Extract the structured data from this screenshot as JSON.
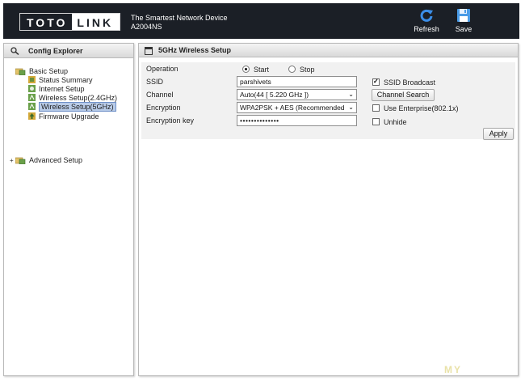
{
  "header": {
    "logo_left": "TOTO",
    "logo_right": "LINK",
    "tagline": "The Smartest Network Device",
    "model": "A2004NS",
    "refresh_label": "Refresh",
    "save_label": "Save"
  },
  "sidebar": {
    "title": "Config Explorer",
    "groups": [
      {
        "label": "Basic Setup",
        "items": [
          {
            "label": "Status Summary"
          },
          {
            "label": "Internet Setup"
          },
          {
            "label": "Wireless Setup(2.4GHz)"
          },
          {
            "label": "Wireless Setup(5GHz)",
            "selected": true
          },
          {
            "label": "Firmware Upgrade"
          }
        ]
      },
      {
        "label": "Advanced Setup",
        "items": []
      }
    ]
  },
  "main": {
    "title": "5GHz Wireless Setup",
    "fields": {
      "operation_label": "Operation",
      "op_start": "Start",
      "op_stop": "Stop",
      "ssid_label": "SSID",
      "ssid_value": "parshivets",
      "channel_label": "Channel",
      "channel_value": "Auto(44 [ 5.220 GHz ])",
      "encryption_label": "Encryption",
      "encryption_value": "WPA2PSK + AES (Recommended",
      "key_label": "Encryption key",
      "key_value": "••••••••••••••"
    },
    "options": {
      "ssid_broadcast": "SSID Broadcast",
      "channel_search": "Channel Search",
      "use_enterprise": "Use Enterprise(802.1x)",
      "unhide": "Unhide"
    },
    "apply_label": "Apply"
  },
  "colors": {
    "header_bg": "#1b1f26",
    "selected_bg": "#b8cbe8",
    "refresh_icon": "#3b8ee8",
    "save_icon": "#4a9be6"
  },
  "watermark": "MY"
}
